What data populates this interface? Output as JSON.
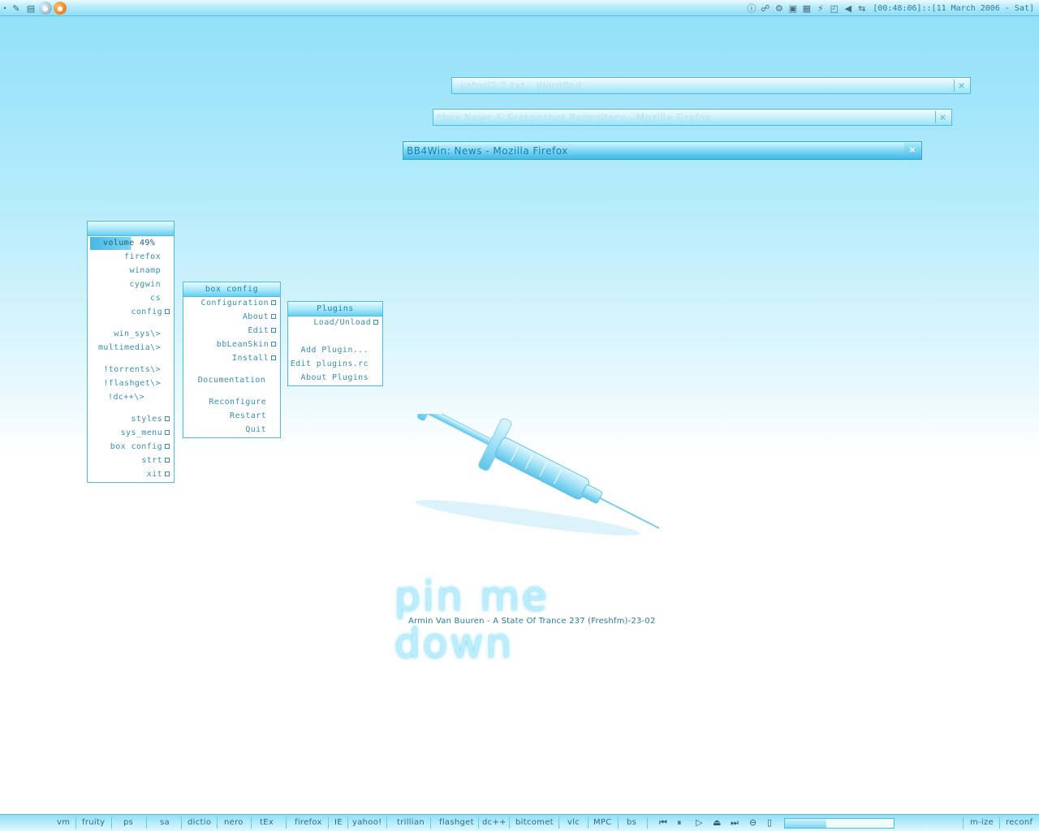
{
  "topbar": {
    "left_icons": [
      "dot-icon",
      "pencil-icon",
      "notepad-icon",
      "globe-icon",
      "firefox-icon"
    ],
    "tray_icons": [
      "info-icon",
      "network-icon",
      "gear-icon",
      "printer-icon",
      "display-icon",
      "lightning-icon",
      "monitor-icon",
      "speaker-icon",
      "transfer-icon"
    ],
    "clock": "[00:48:06]::[11 March 2006 - Sat]"
  },
  "windows": [
    {
      "title": "satori2.2.txt - WordPad",
      "active": false
    },
    {
      "title": "*box News & Screenshot Repository - Mozilla Firefox",
      "active": false
    },
    {
      "title": "BB4Win: News - Mozilla Firefox",
      "active": true
    }
  ],
  "close_glyph": "×",
  "root_menu": {
    "title": "",
    "items": [
      "volume 49%",
      "firefox",
      "winamp",
      "cygwin",
      "cs",
      "config",
      "win_sys\\>",
      "multimedia\\>",
      "!torrents\\>",
      "!flashget\\>",
      "!dc++\\>",
      "styles",
      "sys_menu",
      "box config",
      "strt",
      "xit"
    ]
  },
  "config_menu": {
    "title": "box config",
    "items": [
      "Configuration",
      "About",
      "Edit",
      "bbLeanSkin",
      "Install",
      "Documentation",
      "Reconfigure",
      "Restart",
      "Quit"
    ]
  },
  "plugins_menu": {
    "title": "Plugins",
    "items": [
      "Load/Unload",
      "Add Plugin...",
      "Edit plugins.rc",
      "About Plugins"
    ]
  },
  "wallpaper": {
    "title": "pin me down",
    "subtitle": "Armin Van Buuren - A State Of Trance 237 (Freshfm)-23-02"
  },
  "taskbar": {
    "tasks": [
      "vm",
      "fruity",
      "ps",
      "sa",
      "dictio",
      "nero",
      "tEx",
      "firefox",
      "IE",
      "yahoo!",
      "trillian",
      "flashget",
      "dc++",
      "bitcomet",
      "vlc",
      "MPC",
      "bs"
    ],
    "media_controls": [
      "previous-icon",
      "pause-icon",
      "play-icon",
      "eject-icon",
      "next-icon",
      "repeat-icon",
      "stop-icon"
    ],
    "media_progress": 0.38,
    "right_buttons": [
      "m-ize",
      "reconf"
    ]
  }
}
